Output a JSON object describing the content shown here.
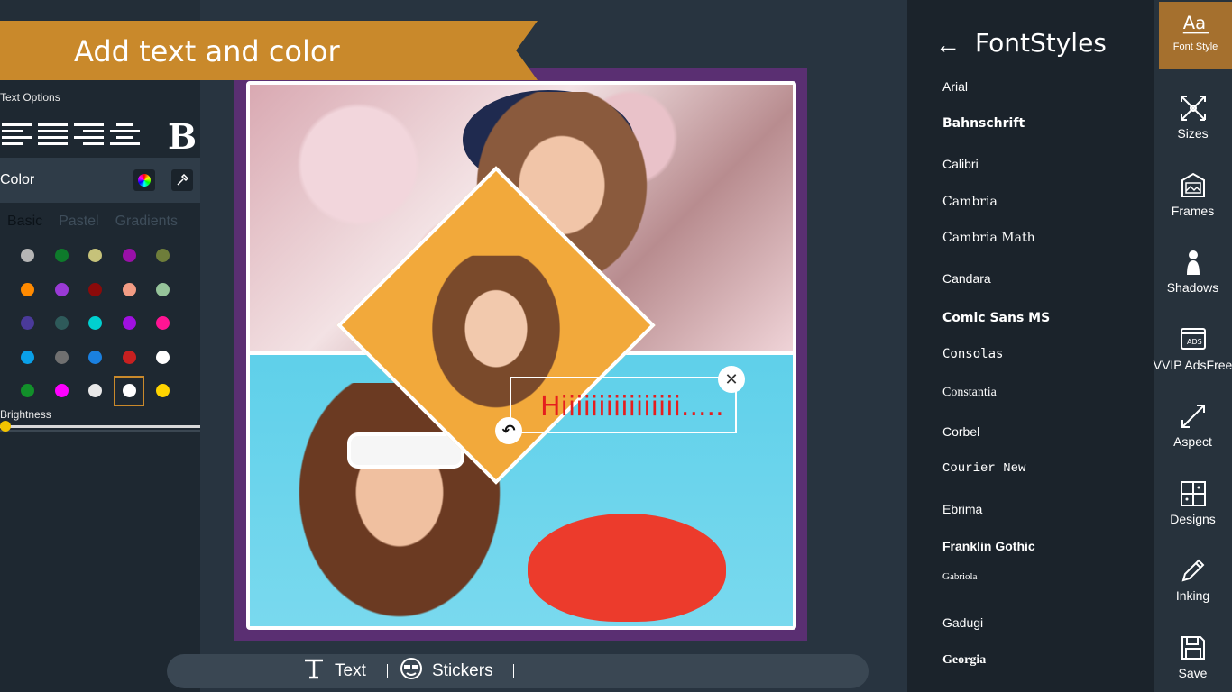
{
  "banner": {
    "title": "Add text and color"
  },
  "left_panel": {
    "text_options_label": "Text Options",
    "bold_label": "B",
    "color_label": "Color",
    "tabs": [
      "Basic",
      "Pastel",
      "Gradients"
    ],
    "swatches": [
      "#b5b5b5",
      "#0e7a2b",
      "#c6c27a",
      "#9a10a8",
      "#6e7d3a",
      "#ff8a00",
      "#9a3ad6",
      "#8b0a0a",
      "#f29c84",
      "#96c49a",
      "#4a3a9a",
      "#2e5a5a",
      "#00d0d0",
      "#a010e0",
      "#ff1493",
      "#0aa0e8",
      "#707070",
      "#1a80e0",
      "#c82020",
      "#ffffff",
      "#12902a",
      "#ff00ff",
      "#e8e8e8",
      "#ffffff",
      "#ffd400"
    ],
    "selected_swatch_index": 23,
    "brightness_label": "Brightness",
    "brightness_value": 0.0
  },
  "canvas": {
    "overlay_text": "Hiiiiiiiiiiiiiiii.....",
    "text_color": "#e51e1e",
    "frame_color": "#5a2f72"
  },
  "bottom_toolbar": {
    "text_label": "Text",
    "stickers_label": "Stickers"
  },
  "font_panel": {
    "title": "FontStyles",
    "fonts": [
      "Arial",
      "Bahnschrift",
      "Calibri",
      "Cambria",
      "Cambria Math",
      "Candara",
      "Comic Sans MS",
      "Consolas",
      "Constantia",
      "Corbel",
      "Courier New",
      "Ebrima",
      "Franklin Gothic",
      "Gabriola",
      "Gadugi",
      "Georgia"
    ]
  },
  "rail": {
    "items": [
      {
        "label": "Font Style",
        "icon": "font-style-icon"
      },
      {
        "label": "Sizes",
        "icon": "sizes-icon"
      },
      {
        "label": "Frames",
        "icon": "frames-icon"
      },
      {
        "label": "Shadows",
        "icon": "shadows-icon"
      },
      {
        "label": "VVIP AdsFree",
        "icon": "ads-free-icon"
      },
      {
        "label": "Aspect",
        "icon": "aspect-icon"
      },
      {
        "label": "Designs",
        "icon": "designs-icon"
      },
      {
        "label": "Inking",
        "icon": "pen-icon"
      },
      {
        "label": "Save",
        "icon": "save-icon"
      }
    ],
    "active_index": 0
  },
  "colors": {
    "accent": "#c9892b",
    "panel": "#1b232b",
    "rail": "#27323c"
  }
}
